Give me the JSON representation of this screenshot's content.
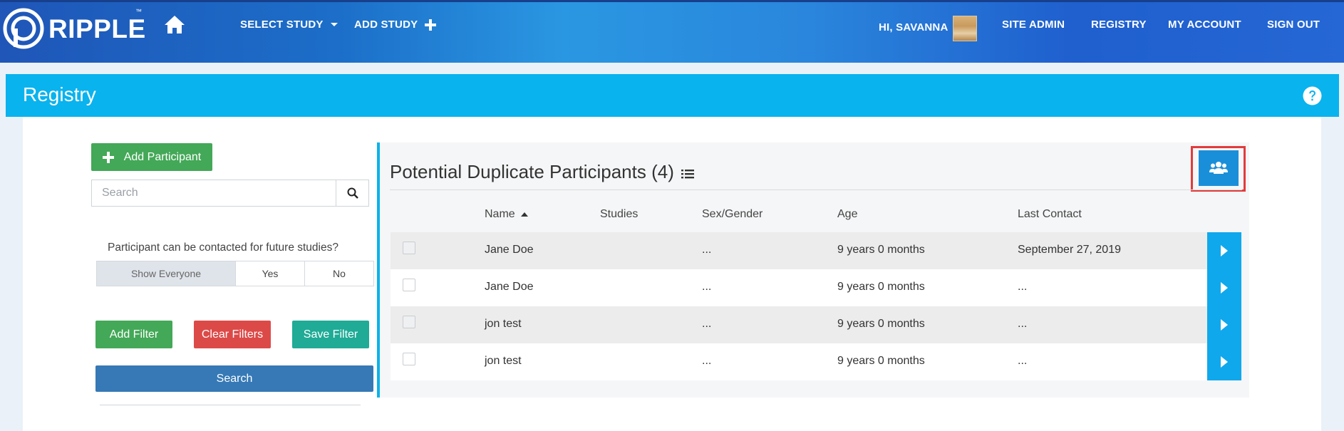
{
  "nav": {
    "brand": "RIPPLE",
    "brand_tm": "™",
    "select_study": "SELECT STUDY",
    "add_study": "ADD STUDY",
    "greeting": "HI, SAVANNA",
    "site_admin": "SITE ADMIN",
    "registry": "REGISTRY",
    "my_account": "MY ACCOUNT",
    "sign_out": "SIGN OUT"
  },
  "page": {
    "title": "Registry"
  },
  "sidebar": {
    "add_participant": "Add Participant",
    "search_placeholder": "Search",
    "contact_question": "Participant can be contacted for future studies?",
    "contact_options": [
      "Show Everyone",
      "Yes",
      "No"
    ],
    "add_filter": "Add Filter",
    "clear_filters": "Clear Filters",
    "save_filter": "Save Filter",
    "search_button": "Search"
  },
  "duplicates": {
    "title": "Potential Duplicate Participants (4)",
    "columns": [
      "Name",
      "Studies",
      "Sex/Gender",
      "Age",
      "Last Contact"
    ],
    "rows": [
      {
        "name": "Jane Doe",
        "studies": "",
        "sex": "...",
        "age": "9 years 0 months",
        "last_contact": "September 27, 2019"
      },
      {
        "name": "Jane Doe",
        "studies": "",
        "sex": "...",
        "age": "9 years 0 months",
        "last_contact": "..."
      },
      {
        "name": "jon test",
        "studies": "",
        "sex": "...",
        "age": "9 years 0 months",
        "last_contact": "..."
      },
      {
        "name": "jon test",
        "studies": "",
        "sex": "...",
        "age": "9 years 0 months",
        "last_contact": "..."
      }
    ]
  },
  "colors": {
    "registry_bar": "#09b3ee",
    "accent_blue": "#10a8ec",
    "green": "#43a857",
    "red": "#dc4a48",
    "teal": "#1fab96",
    "search_blue": "#3679b6",
    "highlight": "#e23b3b"
  }
}
